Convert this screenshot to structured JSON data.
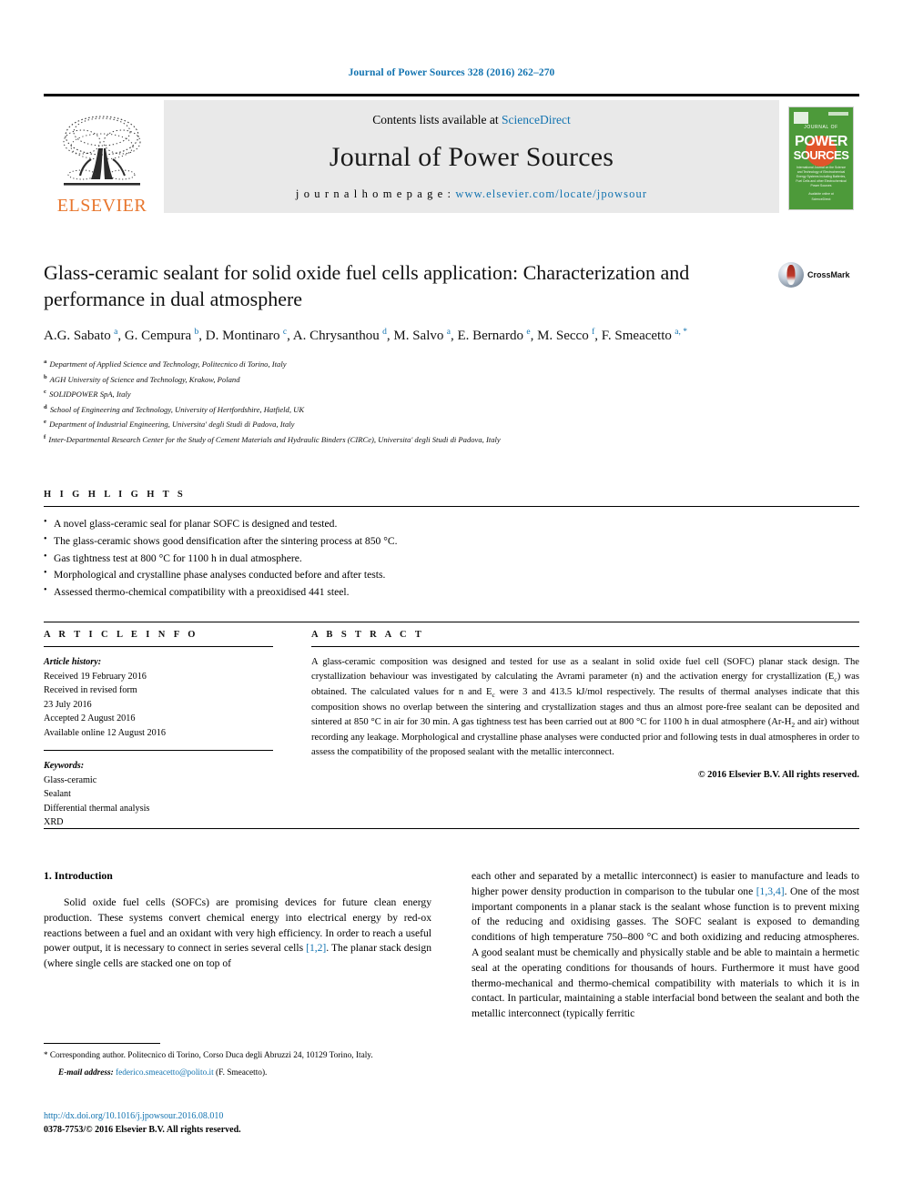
{
  "running_head": "Journal of Power Sources 328 (2016) 262–270",
  "masthead": {
    "elsevier_logo_text": "ELSEVIER",
    "contents_prefix": "Contents lists available at ",
    "contents_link": "ScienceDirect",
    "journal_title": "Journal of Power Sources",
    "homepage_prefix": "j o u r n a l   h o m e p a g e :   ",
    "homepage_url": "www.elsevier.com/locate/jpowsour",
    "cover": {
      "jof": "JOURNAL OF",
      "word1": "POWER",
      "word2": "SOURCES",
      "blurb": "International Journal on the Science and Technology of Electrochemical Energy Systems including Batteries, Fuel Cells and other Electrochemical Power Sources",
      "footer": "Available online at\nScienceDirect"
    }
  },
  "article": {
    "title": "Glass-ceramic sealant for solid oxide fuel cells application: Characterization and performance in dual atmosphere",
    "crossmark_label": "CrossMark",
    "authors": [
      {
        "name": "A.G. Sabato",
        "marks": "a"
      },
      {
        "name": "G. Cempura",
        "marks": "b"
      },
      {
        "name": "D. Montinaro",
        "marks": "c"
      },
      {
        "name": "A. Chrysanthou",
        "marks": "d"
      },
      {
        "name": "M. Salvo",
        "marks": "a"
      },
      {
        "name": "E. Bernardo",
        "marks": "e"
      },
      {
        "name": "M. Secco",
        "marks": "f"
      },
      {
        "name": "F. Smeacetto",
        "marks": "a, *"
      }
    ],
    "affiliations": [
      {
        "mark": "a",
        "text": "Department of Applied Science and Technology, Politecnico di Torino, Italy"
      },
      {
        "mark": "b",
        "text": "AGH University of Science and Technology, Krakow, Poland"
      },
      {
        "mark": "c",
        "text": "SOLIDPOWER SpA, Italy"
      },
      {
        "mark": "d",
        "text": "School of Engineering and Technology, University of Hertfordshire, Hatfield, UK"
      },
      {
        "mark": "e",
        "text": "Department of Industrial Engineering, Universita' degli Studi di Padova, Italy"
      },
      {
        "mark": "f",
        "text": "Inter-Departmental Research Center for the Study of Cement Materials and Hydraulic Binders (CIRCe), Universita' degli Studi di Padova, Italy"
      }
    ]
  },
  "highlights": {
    "label": "H I G H L I G H T S",
    "items": [
      "A novel glass-ceramic seal for planar SOFC is designed and tested.",
      "The glass-ceramic shows good densification after the sintering process at 850 °C.",
      "Gas tightness test at 800 °C for 1100 h in dual atmosphere.",
      "Morphological and crystalline phase analyses conducted before and after tests.",
      "Assessed thermo-chemical compatibility with a preoxidised 441 steel."
    ]
  },
  "article_info": {
    "label": "A R T I C L E   I N F O",
    "history_label": "Article history:",
    "history": [
      "Received 19 February 2016",
      "Received in revised form",
      "23 July 2016",
      "Accepted 2 August 2016",
      "Available online 12 August 2016"
    ],
    "keywords_label": "Keywords:",
    "keywords": [
      "Glass-ceramic",
      "Sealant",
      "Differential thermal analysis",
      "XRD"
    ]
  },
  "abstract": {
    "label": "A B S T R A C T",
    "part1": "A glass-ceramic composition was designed and tested for use as a sealant in solid oxide fuel cell (SOFC) planar stack design. The crystallization behaviour was investigated by calculating the Avrami parameter (n) and the activation energy for crystallization (E",
    "sub1": "c",
    "part2": ") was obtained. The calculated values for n and E",
    "sub2": "c",
    "part3": " were 3 and 413.5 kJ/mol respectively. The results of thermal analyses indicate that this composition shows no overlap between the sintering and crystallization stages and thus an almost pore-free sealant can be deposited and sintered at 850 °C in air for 30 min. A gas tightness test has been carried out at 800 °C for 1100 h in dual atmosphere (Ar-H",
    "sub3": "2",
    "part4": " and air) without recording any leakage. Morphological and crystalline phase analyses were conducted prior and following tests in dual atmospheres in order to assess the compatibility of the proposed sealant with the metallic interconnect.",
    "copyright": "© 2016 Elsevier B.V. All rights reserved."
  },
  "body": {
    "section_heading": "1. Introduction",
    "left_part1": "Solid oxide fuel cells (SOFCs) are promising devices for future clean energy production. These systems convert chemical energy into electrical energy by red-ox reactions between a fuel and an oxidant with very high efficiency. In order to reach a useful power output, it is necessary to connect in series several cells ",
    "left_ref1": "[1,2]",
    "left_part2": ". The planar stack design (where single cells are stacked one on top of",
    "right_part1": "each other and separated by a metallic interconnect) is easier to manufacture and leads to higher power density production in comparison to the tubular one ",
    "right_ref1": "[1,3,4]",
    "right_part2": ". One of the most important components in a planar stack is the sealant whose function is to prevent mixing of the reducing and oxidising gasses. The SOFC sealant is exposed to demanding conditions of high temperature 750–800 °C and both oxidizing and reducing atmospheres. A good sealant must be chemically and physically stable and be able to maintain a hermetic seal at the operating conditions for thousands of hours. Furthermore it must have good thermo-mechanical and thermo-chemical compatibility with materials to which it is in contact. In particular, maintaining a stable interfacial bond between the sealant and both the metallic interconnect (typically ferritic"
  },
  "footer": {
    "corresponding_marker": "*",
    "corresponding_text": " Corresponding author. Politecnico di Torino, Corso Duca degli Abruzzi 24, 10129 Torino, Italy.",
    "email_label": "E-mail address:",
    "email": "federico.smeacetto@polito.it",
    "email_suffix": " (F. Smeacetto).",
    "doi": "http://dx.doi.org/10.1016/j.jpowsour.2016.08.010",
    "issn_line": "0378-7753/© 2016 Elsevier B.V. All rights reserved."
  },
  "colors": {
    "link": "#1273b0",
    "elsevier_orange": "#e8762d",
    "cover_green": "#4d9a3a",
    "cover_sun": "#e1552a",
    "masthead_bg": "#e9e9e9"
  }
}
